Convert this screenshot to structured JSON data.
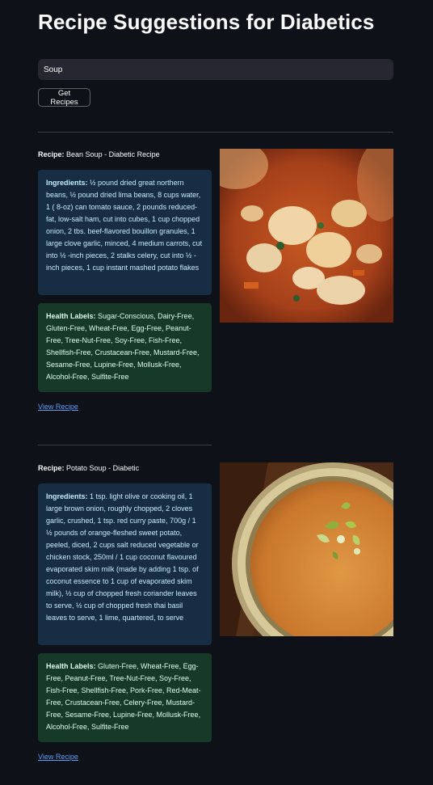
{
  "app": {
    "title": "Recipe Suggestions for Diabetics",
    "search": {
      "value": "Soup",
      "placeholder": ""
    },
    "get_button": "Get Recipes"
  },
  "labels": {
    "recipe": "Recipe:",
    "ingredients": "Ingredients:",
    "health": "Health Labels:",
    "view": "View Recipe"
  },
  "recipes": [
    {
      "name": "Bean Soup - Diabetic Recipe",
      "ingredients": "½ pound dried great northern beans, ½ pound dried lima beans, 8 cups water, 1 ( 8-oz) can tomato sauce, 2 pounds reduced-fat, low-salt ham, cut into cubes, 1 cup chopped onion, 2 tbs. beef-flavored bouillon granules, 1 large clove garlic, minced, 4 medium carrots, cut into ½ -inch pieces, 2 stalks celery, cut into ½ -inch pieces, 1 cup instant mashed potato flakes",
      "health_labels": "Sugar-Conscious, Dairy-Free, Gluten-Free, Wheat-Free, Egg-Free, Peanut-Free, Tree-Nut-Free, Soy-Free, Fish-Free, Shellfish-Free, Crustacean-Free, Mustard-Free, Sesame-Free, Lupine-Free, Mollusk-Free, Alcohol-Free, Sulfite-Free",
      "image": "bean-soup-photo"
    },
    {
      "name": "Potato Soup - Diabetic",
      "ingredients": "1 tsp. light olive or cooking oil, 1 large brown onion, roughly chopped, 2 cloves garlic, crushed, 1 tsp. red curry paste, 700g / 1 ½ pounds of orange-fleshed sweet potato, peeled, diced, 2 cups salt reduced vegetable or chicken stock, 250ml / 1 cup coconut flavoured evaporated skim milk (made by adding 1 tsp. of coconut essence to 1 cup of evaporated skim milk), ½ cup of chopped fresh coriander leaves to serve, ½ cup of chopped fresh thai basil leaves to serve, 1 lime, quartered, to serve",
      "health_labels": "Gluten-Free, Wheat-Free, Egg-Free, Peanut-Free, Tree-Nut-Free, Soy-Free, Fish-Free, Shellfish-Free, Pork-Free, Red-Meat-Free, Crustacean-Free, Celery-Free, Mustard-Free, Sesame-Free, Lupine-Free, Mollusk-Free, Alcohol-Free, Sulfite-Free",
      "image": "sweet-potato-soup-photo"
    }
  ],
  "colors": {
    "background": "#0e1117",
    "input": "#262730",
    "ingredients_box": "#172d43",
    "health_box": "#173928",
    "link": "#5b9df7"
  }
}
